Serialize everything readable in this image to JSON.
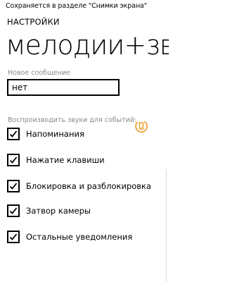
{
  "status_bar": {
    "text": "Сохраняется в разделе \"Снимки экрана\""
  },
  "header": {
    "section": "НАСТРОЙКИ",
    "title": "мелодии+звуки"
  },
  "new_message": {
    "label": "Новое сообщение",
    "value": "нет"
  },
  "events": {
    "label": "Воспроизводить звуки для событий:",
    "items": [
      {
        "label": "Напоминания",
        "checked": true
      },
      {
        "label": "Нажатие клавиши",
        "checked": true
      },
      {
        "label": "Блокировка и разблокировка",
        "checked": true
      },
      {
        "label": "Затвор камеры",
        "checked": true
      },
      {
        "label": "Остальные уведомления",
        "checked": true
      }
    ]
  },
  "colors": {
    "accent": "#f0961e",
    "label_gray": "#8a8a8a"
  },
  "icons": {
    "checkbox": "checkmark-icon",
    "loading": "phone-ringing-icon"
  }
}
